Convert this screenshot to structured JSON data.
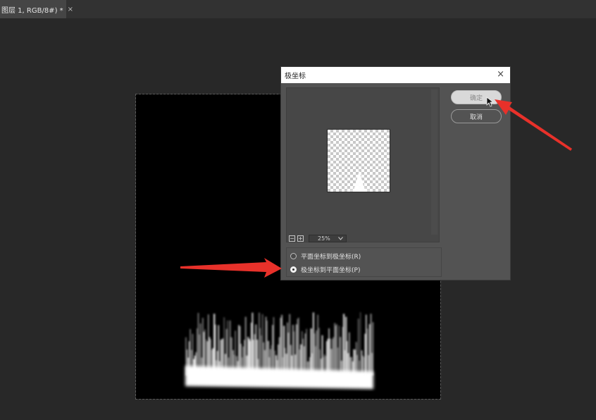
{
  "tab": {
    "title": "图层 1, RGB/8#) *",
    "close": "×"
  },
  "dialog": {
    "title": "极坐标",
    "close": "×",
    "ok_label": "确定",
    "cancel_label": "取消",
    "zoom": {
      "minus": "−",
      "plus": "+",
      "value": "25%"
    },
    "options": [
      {
        "label": "平面坐标到极坐标(R)",
        "selected": false
      },
      {
        "label": "极坐标到平面坐标(P)",
        "selected": true
      }
    ]
  },
  "icons": [
    "close-icon",
    "zoom-out-icon",
    "zoom-in-icon",
    "chevron-down-icon",
    "radio-icon",
    "annotation-arrow-icon",
    "mouse-cursor-icon"
  ],
  "colors": {
    "annotation_arrow": "#e8312a",
    "workspace": "#282828",
    "dialog": "#535353"
  }
}
